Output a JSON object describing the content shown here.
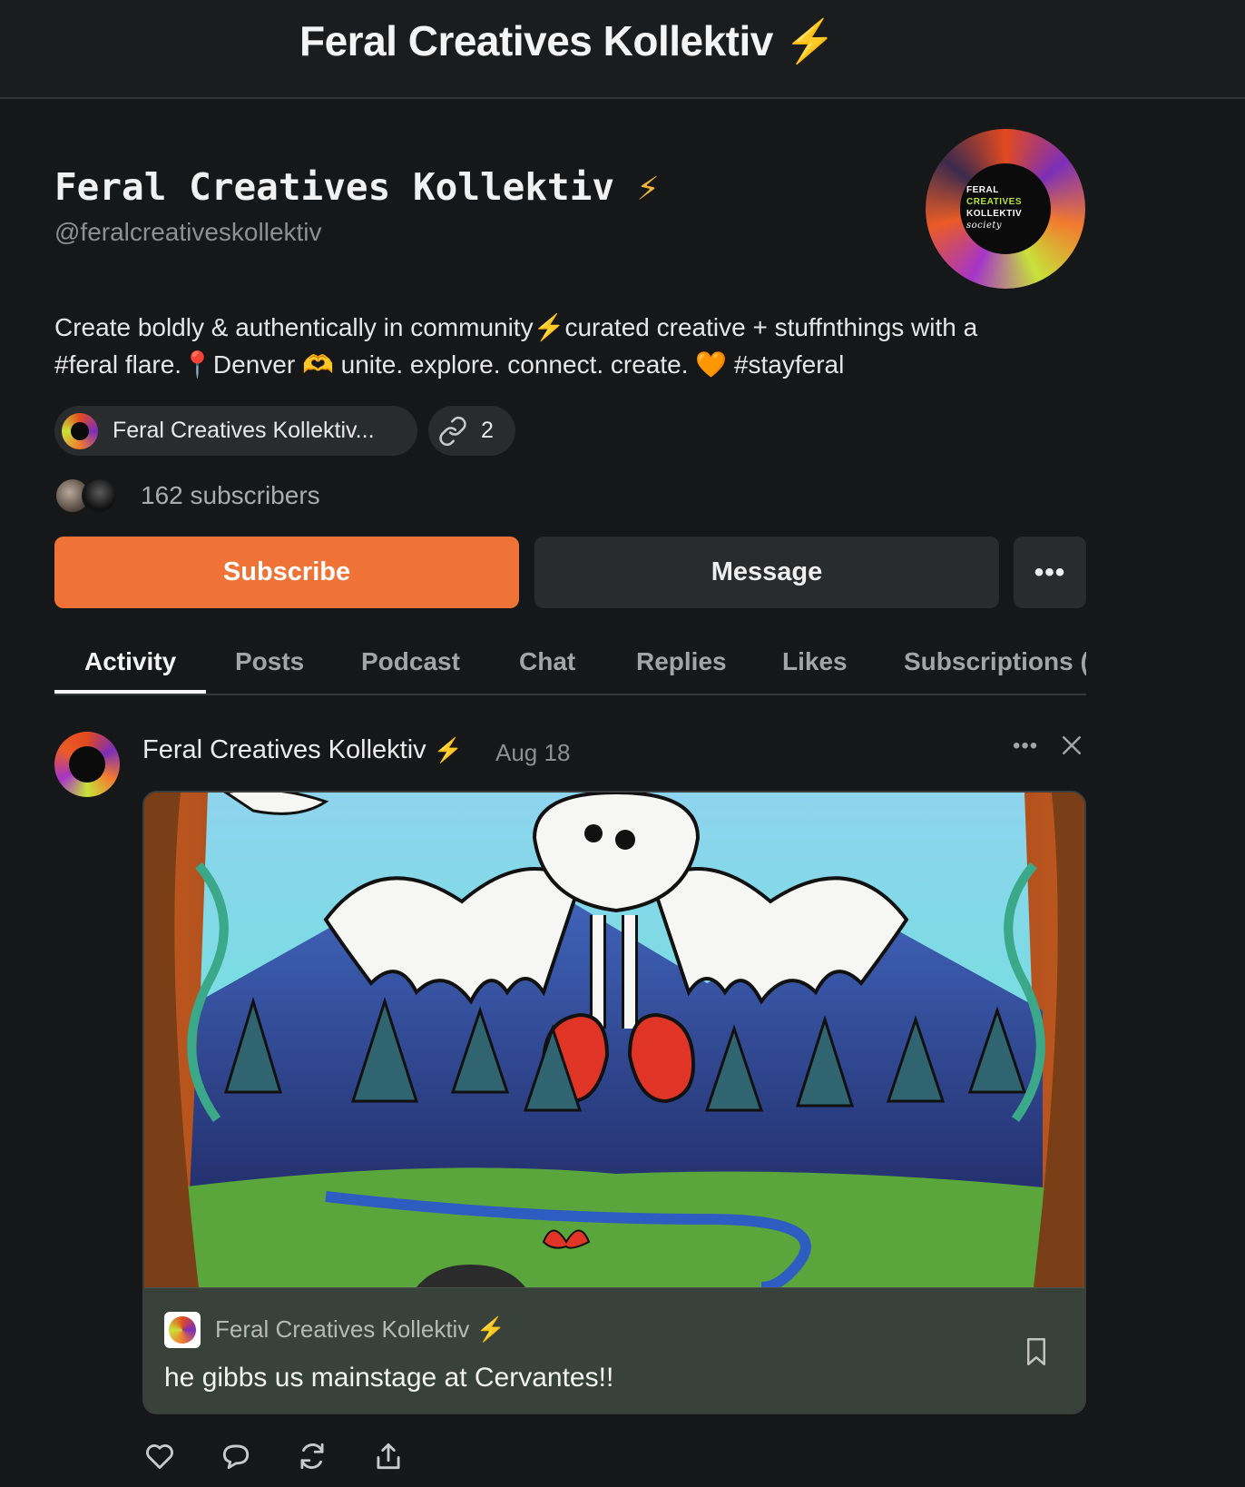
{
  "header": {
    "title": "Feral Creatives Kollektiv",
    "bolt": "⚡"
  },
  "profile": {
    "name": "Feral Creatives Kollektiv",
    "bolt": "⚡",
    "handle": "@feralcreativeskollektiv",
    "avatar_text": [
      "FERAL",
      "CREATIVES",
      "KOLLEKTIV",
      "society"
    ],
    "bio_line1": "Create boldly & authentically in community⚡curated creative + stuffnthings with a",
    "bio_line2": "#feral flare.📍Denver 🫶 unite. explore. connect. create. 🧡 #stayferal"
  },
  "pills": {
    "publication": "Feral Creatives Kollektiv...",
    "links_count": "2"
  },
  "subscribers": {
    "text": "162 subscribers"
  },
  "buttons": {
    "subscribe": "Subscribe",
    "message": "Message",
    "more": "•••"
  },
  "tabs": [
    "Activity",
    "Posts",
    "Podcast",
    "Chat",
    "Replies",
    "Likes",
    "Subscriptions ("
  ],
  "post": {
    "author": "Feral Creatives Kollektiv",
    "bolt": "⚡",
    "date": "Aug 18",
    "more": "•••",
    "card": {
      "publication": "Feral Creatives Kollektiv",
      "bolt": "⚡",
      "title": "he gibbs us mainstage at Cervantes!!"
    }
  },
  "icons": [
    "bolt-icon",
    "link-icon",
    "more-icon",
    "close-icon",
    "bookmark-icon",
    "heart-icon",
    "comment-icon",
    "restack-icon",
    "share-icon"
  ],
  "colors": {
    "accent": "#ef7337",
    "background": "#161718",
    "surface": "#2a2b2d",
    "card_footer": "#38413a"
  }
}
